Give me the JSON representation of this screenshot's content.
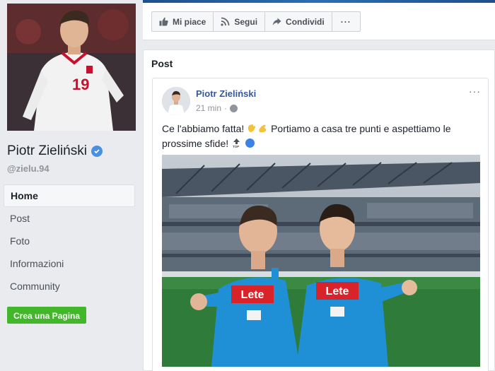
{
  "profile": {
    "name": "Piotr Zieliński",
    "handle": "@zielu.94",
    "photo_jersey_number": "19"
  },
  "sidebar": {
    "items": [
      {
        "label": "Home",
        "active": true
      },
      {
        "label": "Post"
      },
      {
        "label": "Foto"
      },
      {
        "label": "Informazioni"
      },
      {
        "label": "Community"
      }
    ],
    "create_page_label": "Crea una Pagina"
  },
  "actions": {
    "like_label": "Mi piace",
    "follow_label": "Segui",
    "share_label": "Condividi",
    "more_label": "···"
  },
  "posts_section": {
    "title": "Post",
    "post": {
      "author": "Piotr Zieliński",
      "time": "21 min",
      "separator": "·",
      "more_label": "···",
      "text_part1": "Ce l'abbiamo fatta! ",
      "text_part2": " Portiamo a casa tre punti e aspettiamo le prossime sfide! ",
      "photo_sponsor_text": "Lete"
    }
  },
  "colors": {
    "link_blue": "#365899",
    "green_button": "#42b72a",
    "page_bg": "#e9ebee",
    "napoli_blue": "#1f8fd6"
  },
  "icons": [
    "verified-badge-icon",
    "thumbs-up-icon",
    "rss-icon",
    "share-arrow-icon",
    "more-icon",
    "globe-icon",
    "clapping-hands-emoji",
    "flexed-biceps-emoji",
    "top-arrow-emoji",
    "blue-circle-emoji"
  ]
}
